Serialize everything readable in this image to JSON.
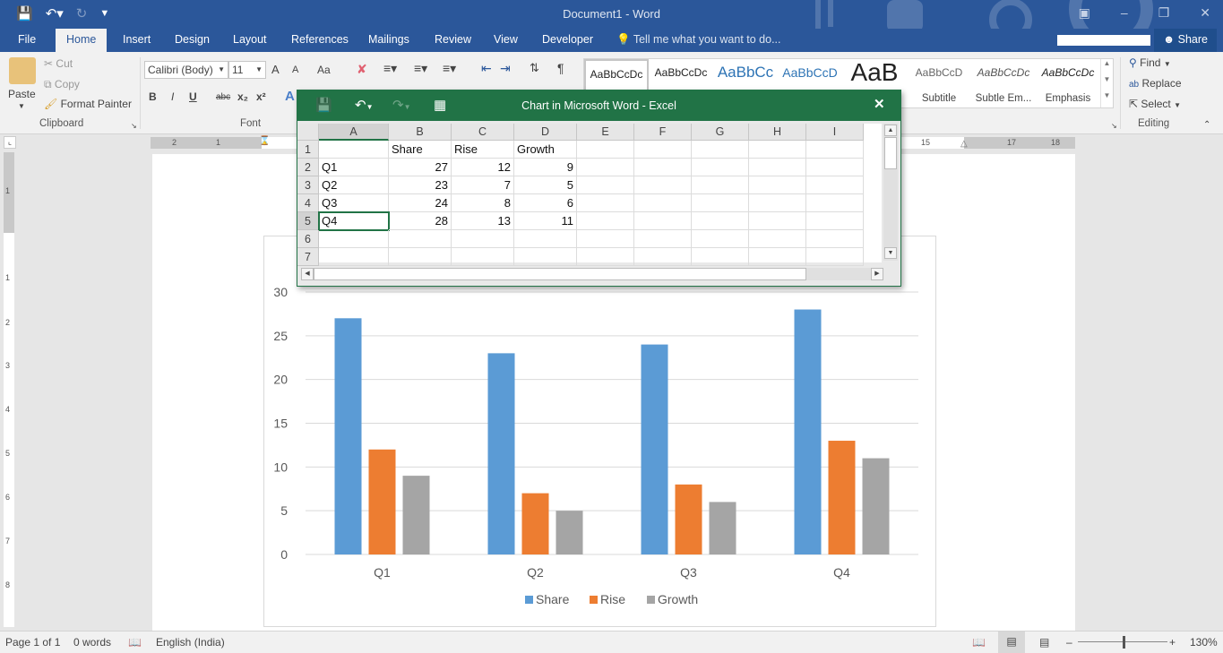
{
  "word": {
    "title": "Document1 - Word",
    "tabs": [
      "File",
      "Home",
      "Insert",
      "Design",
      "Layout",
      "References",
      "Mailings",
      "Review",
      "View",
      "Developer"
    ],
    "active_tab": "Home",
    "tell_me": "Tell me what you want to do...",
    "share": "Share",
    "clipboard": {
      "paste": "Paste",
      "cut": "Cut",
      "copy": "Copy",
      "format_painter": "Format Painter",
      "group": "Clipboard"
    },
    "font": {
      "name": "Calibri (Body)",
      "size": "11",
      "group": "Font",
      "bold": "B",
      "italic": "I",
      "underline": "U",
      "strike": "abc",
      "sub": "x₂",
      "sup": "x²",
      "grow": "A",
      "shrink": "A",
      "case": "Aa"
    },
    "styles": [
      {
        "sample": "AaBbCcDc",
        "name": ""
      },
      {
        "sample": "AaBbCcDc",
        "name": ""
      },
      {
        "sample": "AaBbCc",
        "name": ""
      },
      {
        "sample": "AaBbCcD",
        "name": ""
      },
      {
        "sample": "AaB",
        "name": ""
      },
      {
        "sample": "AaBbCcD",
        "name": "Subtitle"
      },
      {
        "sample": "AaBbCcDc",
        "name": "Subtle Em..."
      },
      {
        "sample": "AaBbCcDc",
        "name": "Emphasis"
      }
    ],
    "editing": {
      "find": "Find",
      "replace": "Replace",
      "select": "Select",
      "group": "Editing"
    },
    "ruler_h": [
      "2",
      "1",
      "15",
      "17",
      "18"
    ],
    "ruler_v": [
      "1",
      "1",
      "2",
      "3",
      "4",
      "5",
      "6",
      "7",
      "8"
    ],
    "status": {
      "page": "Page 1 of 1",
      "words": "0 words",
      "language": "English (India)",
      "zoom": "130%"
    }
  },
  "excel": {
    "title": "Chart in Microsoft Word - Excel",
    "columns": [
      "A",
      "B",
      "C",
      "D",
      "E",
      "F",
      "G",
      "H",
      "I"
    ],
    "rows": [
      "1",
      "2",
      "3",
      "4",
      "5",
      "6",
      "7"
    ],
    "cells": [
      [
        "",
        "Share",
        "Rise",
        "Growth"
      ],
      [
        "Q1",
        "27",
        "12",
        "9"
      ],
      [
        "Q2",
        "23",
        "7",
        "5"
      ],
      [
        "Q3",
        "24",
        "8",
        "6"
      ],
      [
        "Q4",
        "28",
        "13",
        "11"
      ],
      [
        "",
        "",
        "",
        ""
      ],
      [
        "",
        "",
        "",
        ""
      ]
    ],
    "selected_cell": "A5"
  },
  "chart_data": {
    "type": "bar",
    "title": "",
    "categories": [
      "Q1",
      "Q2",
      "Q3",
      "Q4"
    ],
    "series": [
      {
        "name": "Share",
        "values": [
          27,
          23,
          24,
          28
        ],
        "color": "#5b9bd5"
      },
      {
        "name": "Rise",
        "values": [
          12,
          7,
          8,
          13
        ],
        "color": "#ed7d31"
      },
      {
        "name": "Growth",
        "values": [
          9,
          5,
          6,
          11
        ],
        "color": "#a5a5a5"
      }
    ],
    "ylim": [
      0,
      30
    ],
    "yticks": [
      "0",
      "5",
      "10",
      "15",
      "20",
      "25",
      "30"
    ],
    "xlabel": "",
    "ylabel": "",
    "grid": true,
    "legend": "bottom"
  }
}
